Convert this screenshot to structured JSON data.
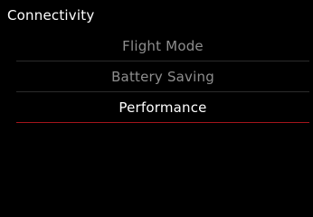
{
  "header": {
    "title": "Connectivity"
  },
  "options": [
    {
      "label": "Flight Mode",
      "selected": false
    },
    {
      "label": "Battery Saving",
      "selected": false
    },
    {
      "label": "Performance",
      "selected": true
    }
  ],
  "colors": {
    "background": "#000000",
    "text_active": "#ffffff",
    "text_inactive": "#8e8e8e",
    "divider": "#2b2b2b",
    "selection_accent": "#a4151b"
  }
}
